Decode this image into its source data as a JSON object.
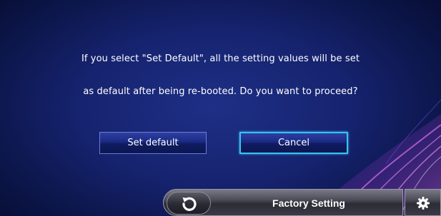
{
  "dialog": {
    "line1": "If you select \"Set Default\", all the setting values will be set",
    "line2": "as default after being re-booted. Do you want to proceed?"
  },
  "buttons": {
    "set_default": "Set default",
    "cancel": "Cancel"
  },
  "bottom_bar": {
    "title": "Factory Setting",
    "back_icon": "back-arrow-icon",
    "settings_icon": "gear-icon"
  },
  "colors": {
    "background": "#16236f",
    "focus_border": "#36c4f2",
    "accent_swoosh": "#c050d8"
  }
}
